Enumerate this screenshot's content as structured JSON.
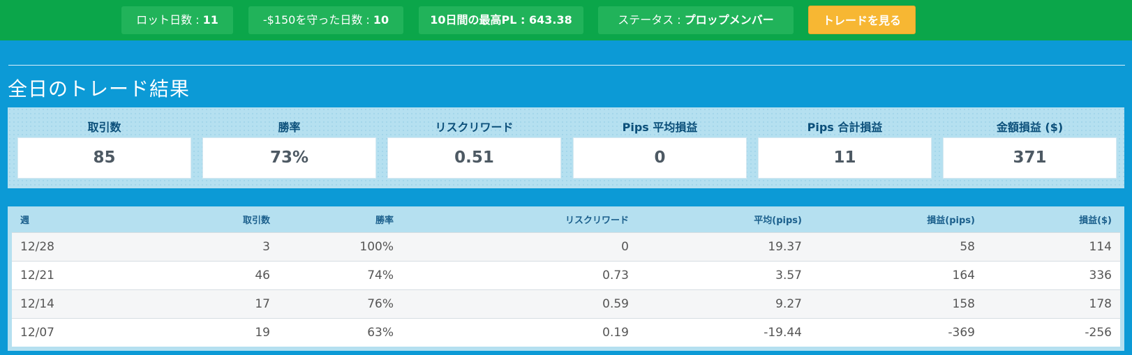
{
  "topbar": {
    "lot_days_label": "ロット日数 : ",
    "lot_days_value": "11",
    "guard_days_label": "-$150を守った日数 : ",
    "guard_days_value": "10",
    "best_pl_label": "10日間の最高PL : ",
    "best_pl_value": "643.38",
    "status_label": "ステータス : ",
    "status_value": "プロップメンバー",
    "view_trades_button": "トレードを見る",
    "accent_color": "#0ba64a",
    "button_color": "#f7b733"
  },
  "section": {
    "title": "全日のトレード結果"
  },
  "summary": [
    {
      "label": "取引数",
      "value": "85"
    },
    {
      "label": "勝率",
      "value": "73%"
    },
    {
      "label": "リスクリワード",
      "value": "0.51"
    },
    {
      "label": "Pips 平均損益",
      "value": "0"
    },
    {
      "label": "Pips 合計損益",
      "value": "11"
    },
    {
      "label": "金額損益 ($)",
      "value": "371"
    }
  ],
  "table": {
    "headers": [
      "週",
      "取引数",
      "勝率",
      "リスクリワード",
      "平均(pips)",
      "損益(pips)",
      "損益($)"
    ],
    "rows": [
      [
        "12/28",
        "3",
        "100%",
        "0",
        "19.37",
        "58",
        "114"
      ],
      [
        "12/21",
        "46",
        "74%",
        "0.73",
        "3.57",
        "164",
        "336"
      ],
      [
        "12/14",
        "17",
        "76%",
        "0.59",
        "9.27",
        "158",
        "178"
      ],
      [
        "12/07",
        "19",
        "63%",
        "0.19",
        "-19.44",
        "-369",
        "-256"
      ]
    ]
  }
}
